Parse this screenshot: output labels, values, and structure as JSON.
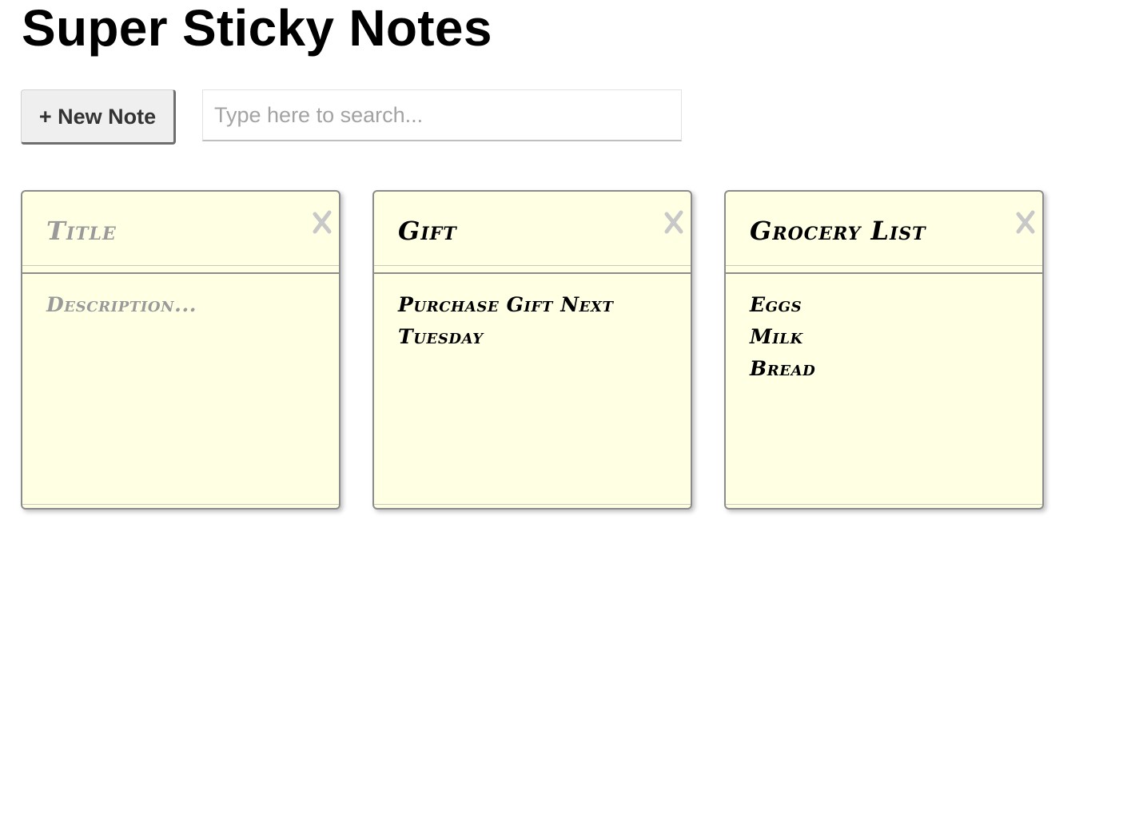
{
  "app": {
    "title": "Super Sticky Notes"
  },
  "toolbar": {
    "new_note_label": "+ New Note",
    "search_placeholder": "Type here to search...",
    "search_value": ""
  },
  "notes": [
    {
      "title": "Title",
      "title_is_placeholder": true,
      "description": "Description...",
      "description_is_placeholder": true
    },
    {
      "title": "Gift",
      "title_is_placeholder": false,
      "description": "Purchase Gift Next\nTuesday",
      "description_is_placeholder": false
    },
    {
      "title": "Grocery List",
      "title_is_placeholder": false,
      "description": "Eggs\nMilk\nBread",
      "description_is_placeholder": false
    }
  ],
  "icons": {
    "close": "close-icon"
  },
  "colors": {
    "note_background": "#ffffe4",
    "note_border": "#8c8c8c",
    "placeholder_text": "#9a9a9a",
    "close_icon": "#c8c8c8"
  }
}
